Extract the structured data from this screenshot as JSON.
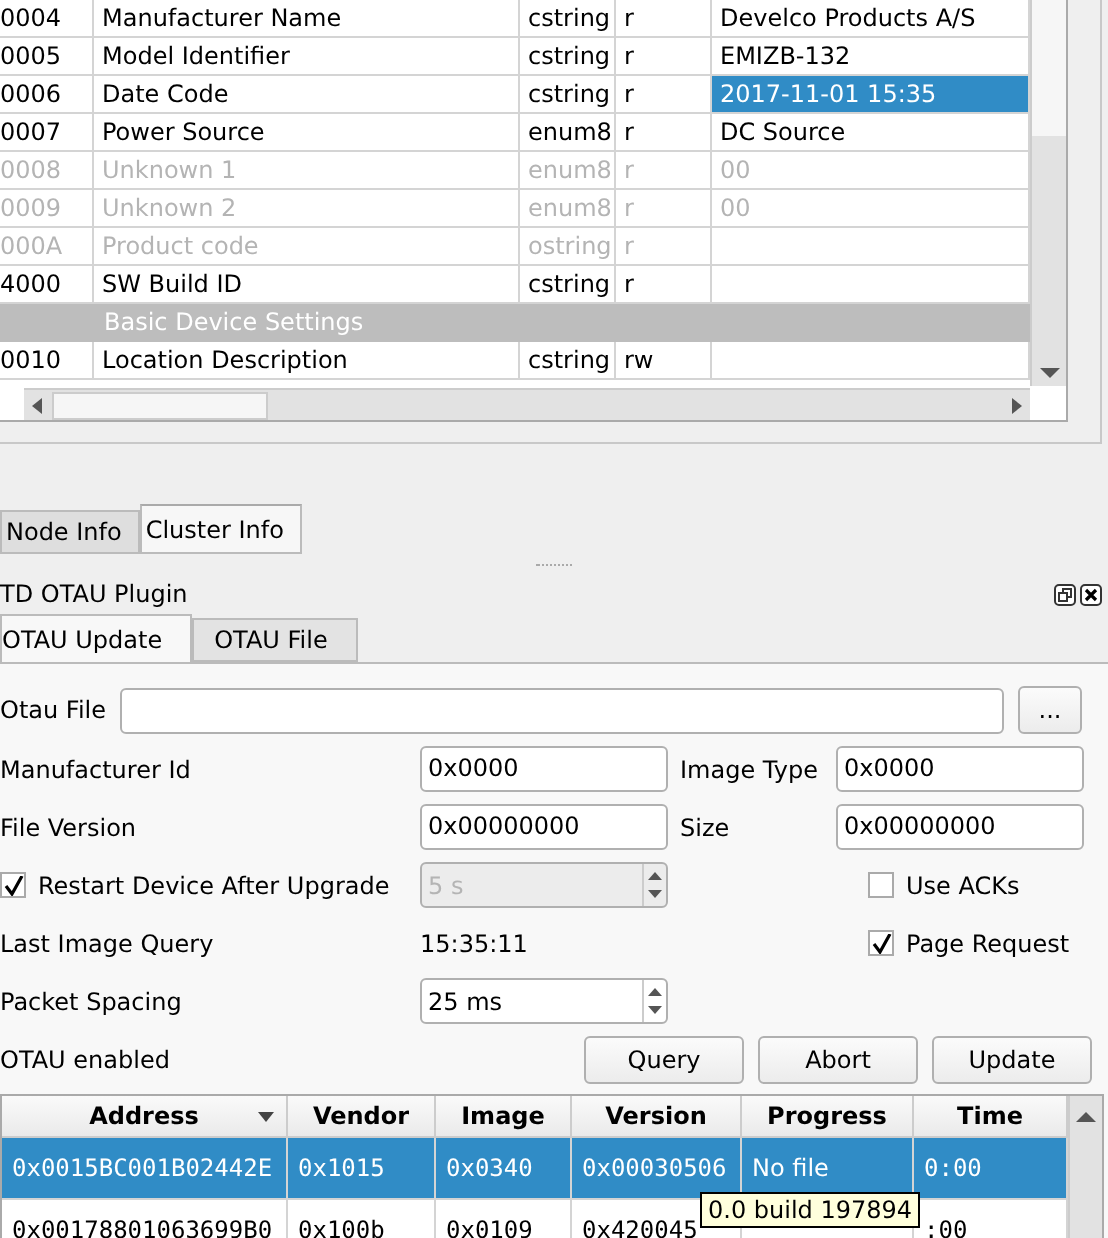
{
  "attributes": {
    "rows": [
      {
        "kind": "attribute",
        "id": "0004",
        "name": "Manufacturer Name",
        "type": "cstring",
        "access": "r",
        "value": "Develco Products A/S",
        "disabled": false,
        "selected": false
      },
      {
        "kind": "attribute",
        "id": "0005",
        "name": "Model Identifier",
        "type": "cstring",
        "access": "r",
        "value": "EMIZB-132",
        "disabled": false,
        "selected": false
      },
      {
        "kind": "attribute",
        "id": "0006",
        "name": "Date Code",
        "type": "cstring",
        "access": "r",
        "value": "2017-11-01 15:35",
        "disabled": false,
        "selected": true
      },
      {
        "kind": "attribute",
        "id": "0007",
        "name": "Power Source",
        "type": "enum8",
        "access": "r",
        "value": "DC Source",
        "disabled": false,
        "selected": false
      },
      {
        "kind": "attribute",
        "id": "0008",
        "name": "Unknown 1",
        "type": "enum8",
        "access": "r",
        "value": "00",
        "disabled": true,
        "selected": false
      },
      {
        "kind": "attribute",
        "id": "0009",
        "name": "Unknown 2",
        "type": "enum8",
        "access": "r",
        "value": "00",
        "disabled": true,
        "selected": false
      },
      {
        "kind": "attribute",
        "id": "000A",
        "name": "Product code",
        "type": "ostring",
        "access": "r",
        "value": "",
        "disabled": true,
        "selected": false
      },
      {
        "kind": "attribute",
        "id": "4000",
        "name": "SW Build ID",
        "type": "cstring",
        "access": "r",
        "value": "",
        "disabled": false,
        "selected": false
      },
      {
        "kind": "group",
        "name": "Basic Device Settings"
      },
      {
        "kind": "attribute",
        "id": "0010",
        "name": "Location Description",
        "type": "cstring",
        "access": "rw",
        "value": "",
        "disabled": false,
        "selected": false
      }
    ]
  },
  "panel_tabs": [
    {
      "label": "Node Info",
      "selected": false
    },
    {
      "label": "Cluster Info",
      "selected": true
    }
  ],
  "plugin": {
    "title": "TD OTAU Plugin",
    "tabs": [
      {
        "label": "OTAU Update",
        "selected": true
      },
      {
        "label": "OTAU File",
        "selected": false
      }
    ],
    "otau_file": {
      "label": "Otau File",
      "button": "..."
    },
    "manufacturer_id": {
      "label": "Manufacturer Id",
      "value": "0x0000"
    },
    "image_type": {
      "label": "Image Type",
      "value": "0x0000"
    },
    "file_version": {
      "label": "File Version",
      "value": "0x00000000"
    },
    "size": {
      "label": "Size",
      "value": "0x00000000"
    },
    "restart": {
      "label": "Restart Device After Upgrade",
      "checked": true,
      "delay": "5 s",
      "delay_disabled": true
    },
    "use_acks": {
      "label": "Use ACKs",
      "checked": false
    },
    "last_query": {
      "label": "Last Image Query",
      "value": "15:35:11"
    },
    "page_request": {
      "label": "Page Request",
      "checked": true
    },
    "packet_spacing": {
      "label": "Packet Spacing",
      "value": "25 ms"
    },
    "status": "OTAU enabled",
    "buttons": [
      "Query",
      "Abort",
      "Update"
    ],
    "table": {
      "columns": [
        "Address",
        "Vendor",
        "Image",
        "Version",
        "Progress",
        "Time"
      ],
      "rows": [
        {
          "selected": true,
          "cells": [
            "0x0015BC001B02442E",
            "0x1015",
            "0x0340",
            "0x00030506",
            "No file",
            "0:00"
          ]
        },
        {
          "selected": false,
          "cells": [
            "0x00178801063699B0",
            "0x100b",
            "0x0109",
            "0x420045",
            "",
            ":00"
          ]
        }
      ]
    },
    "tooltip": "0.0 build 197894"
  }
}
